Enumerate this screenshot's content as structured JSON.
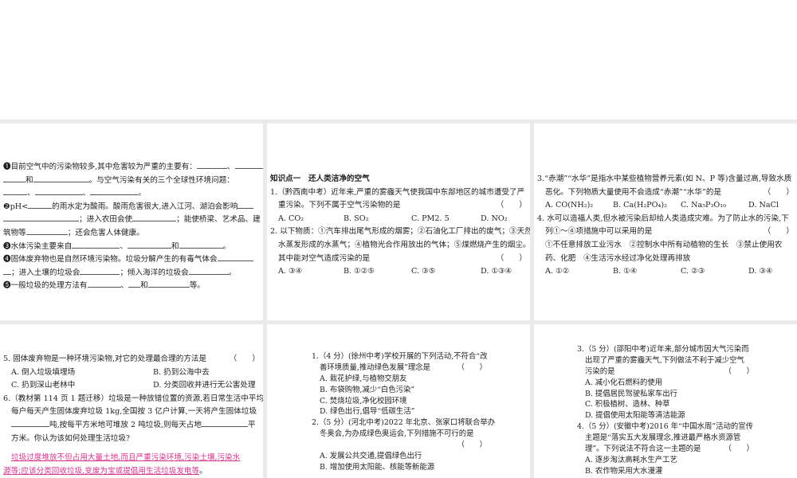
{
  "p1": {
    "lines": [
      "❶目前空气中的污染物较多,其中危害较为严重的主要有：",
      "和",
      "。与空气污染有关的三个全球性环境问题：",
      "❷pH<",
      "的雨水定为酸雨。酸雨危害很大,进入江河、湖泊会影响",
      "；进入农田会使",
      "；能使桥梁、艺术品、建",
      "筑物等",
      "；还会危害人体健康。",
      "❸水体污染主要来自",
      "❹固体废弃物也是自然环境污染物。垃圾分解产生的有毒气体会",
      "；进入土壤的垃圾会",
      "；倾入海洋的垃圾会",
      "❺一般垃圾的处理方法有",
      "等。"
    ]
  },
  "p2": {
    "heading": "知识点一　还人类洁净的空气",
    "q1": {
      "stem1": "1.（黔西南中考）近年来,严重的雾霾天气使我国中东部地区的城市遭受了严",
      "stem2": "重污染。下列不属于空气污染物的是",
      "bracket": "（　　）",
      "options": [
        "A. CO₂",
        "B. SO₂",
        "C. PM2. 5",
        "D. NO₂"
      ]
    },
    "q2": {
      "stem1": "2. 以下物质：①汽车排出尾气形成的烟雾；②石油化工厂排出的废气；③天然",
      "stem2": "水蒸发形成的水蒸气；④植物光合作用放出的气体；⑤煤燃烧产生的烟尘。",
      "stem3": "其中能对空气造成污染的是",
      "bracket": "（　　）",
      "options": [
        "A. ③④",
        "B. ①②⑤",
        "C. ③⑤",
        "D. ①③④"
      ]
    }
  },
  "p3": {
    "q3": {
      "stem1": "3.“赤潮”“水华”是指水中某些植物营养元素(如 N、P 等)含量过高,导致水质",
      "stem2": "恶化。下列物质大量使用不会造成“赤潮”“水华”的是",
      "bracket": "（　　）",
      "options": [
        "A. CO(NH₂)₂",
        "B. Ca(H₂PO₄)₂",
        "C. Na₅P₃O₁₀",
        "D. NaCl"
      ]
    },
    "q4": {
      "stem1": "4. 水可以造福人类,但水被污染后却给人类造成灾难。为了防止水的污染,下",
      "stem2": "列①～④项措施中可以采用的是",
      "bracket": "（　　）",
      "stem3": "①不任意排放工业污水　②控制水中所有动植物的生长　③禁止使用农",
      "stem4": "药、化肥　④生活污水经过净化处理再排放",
      "options": [
        "A. ①②",
        "B. ①④",
        "C. ②③",
        "D. ③④"
      ]
    }
  },
  "p4": {
    "q5": {
      "stem": "5. 固体废弃物是一种环境污染物,对它的处理最合理的方法是",
      "bracket": "（　　）",
      "options": [
        "A. 倒入垃圾填埋场",
        "B. 扔到公海中去",
        "C. 扔到深山老林中",
        "D. 分类回收并进行无公害处理"
      ]
    },
    "q6": {
      "stem1": "6.（教材第 114 页 1 题迁移）垃圾是一种放错位置的资源,若日常生活中平均",
      "stem2": "每户每天产生固体废弃垃圾 1kg,全国按 3 亿户计算,一天将产生固体垃圾",
      "stem3a": "吨,按每平方米地可堆放 2 吨垃圾,则每天占地",
      "stem3b": "平",
      "stem4": "方米。你认为该如何处理生活垃圾?",
      "answer1": "垃圾过度堆放不但占用大量土地,而且严重污染环境,污染土壤,污染水",
      "answer2": "源等;应该分类回收垃圾,变废为宝或提倡用生活垃圾发电等",
      "end": "。"
    }
  },
  "p5": {
    "q1": {
      "stem1": "1.（4 分）(徐州中考)学校开展的下列活动,不符合“改",
      "stem2": "善环境质量,推动绿色发展”理念是",
      "bracket": "（　　）",
      "options": [
        "A. 栽花护绿,与植物交朋友",
        "B. 布袋购物,减少“白色污染”",
        "C. 焚烧垃圾,净化校园环境",
        "D. 绿色出行,倡导“低碳生活”"
      ]
    },
    "q2": {
      "stem1": "2.（5 分）(河北中考)2022 年北京、张家口将联合举办",
      "stem2": "冬奥会,为办成绿色奥运会,下列措施不可行的是",
      "bracket": "（　　）",
      "options": [
        "A. 发展公共交通,提倡绿色出行",
        "B. 增加使用太阳能、核能等新能源"
      ]
    }
  },
  "p6": {
    "q3": {
      "stem1": "3.（5 分）(邵阳中考)近年来,部分城市因大气污染而",
      "stem2": "出现了严重的雾霾天气,下列做法不利于减少空气",
      "stem3": "污染的是",
      "bracket": "（　　）",
      "options": [
        "A. 减小化石燃料的使用",
        "B. 提倡居民驾驶私家车出行",
        "C. 积极植树、造林、种草",
        "D. 提倡使用太阳能等清洁能源"
      ]
    },
    "q4": {
      "stem1": "4.（5 分）(安徽中考)2016 年“中国水周”活动的宣传",
      "stem2": "主题是“落实五大发展理念,推进最严格水资源管",
      "stem3": "理”。下列说法不符合这一主题的是",
      "bracket": "（　　）",
      "options": [
        "A. 逐步淘汰高耗水生产工艺",
        "B. 农作物采用大水漫灌"
      ]
    }
  }
}
